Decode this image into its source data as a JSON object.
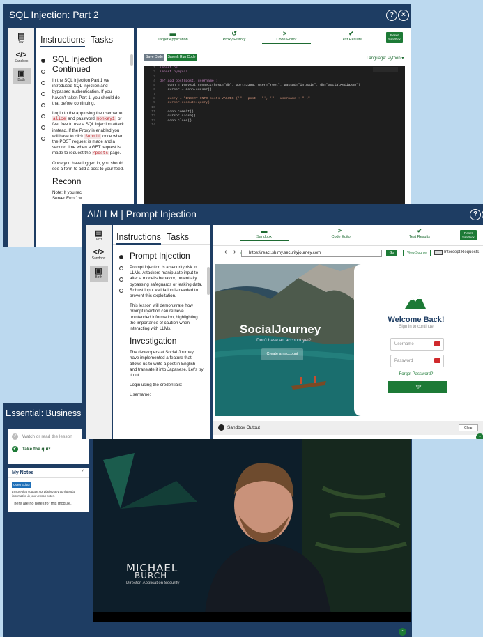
{
  "win1": {
    "title": "SQL Injection: Part 2",
    "help_icon": "?",
    "close_icon": "×",
    "sidebar": [
      {
        "label": "Text"
      },
      {
        "label": "Sandbox"
      },
      {
        "label": "Both"
      }
    ],
    "tabs": [
      "Instructions",
      "Tasks"
    ],
    "heading": "SQL Injection Continued",
    "p1": "In the SQL Injection Part 1 we introduced SQL Injection and bypassed authentication. If you haven't taken Part 1, you should do that before continuing.",
    "p2_a": "Login to the app using the username ",
    "p2_user": "alice",
    "p2_b": " and password ",
    "p2_pass": "monkey1",
    "p2_c": ", or feel free to use a SQL Injection attack instead. If the Proxy is enabled you will have to click ",
    "p2_submit": "Submit",
    "p2_d": " once when the POST request is made and a second time when a GET request is made to request the ",
    "p2_posts": "/posts",
    "p2_e": " page.",
    "p3": "Once you have logged in, you should see a form to add a post to your feed.",
    "heading2": "Reconn",
    "note": "Note: If you rec",
    "note2": "Server Error\" w",
    "nav": [
      {
        "label": "Target Application",
        "icon": "▬"
      },
      {
        "label": "Proxy History",
        "icon": "↺"
      },
      {
        "label": "Code Editor",
        "icon": ">_"
      },
      {
        "label": "Test Results",
        "icon": "✔"
      }
    ],
    "reset_l1": "Reset",
    "reset_l2": "Sandbox",
    "save_code": "Save Code",
    "save_run": "Save & Run Code",
    "language": "Language: Python ▾",
    "line_numbers": [
      "1",
      "2",
      "3",
      "4",
      "5",
      "6",
      "7",
      "8",
      "9",
      "10",
      "11",
      "12",
      "13",
      "14"
    ],
    "code": [
      "import os",
      "import pymysql",
      "",
      "def add_post(post, username):",
      "    conn = pymysql.connect(host=\"db\", port=3306, user=\"root\", passwd=\"intmain\", db=\"SocialMediaApp\")",
      "    cursor = conn.cursor()",
      "",
      "    query = \"INSERT INTO posts VALUES ('\" + post + \"', '\" + username + \"')\"",
      "    cursor.execute(query)",
      "",
      "    conn.commit()",
      "    cursor.close()",
      "    conn.close()",
      ""
    ]
  },
  "win2": {
    "title": "AI/LLM | Prompt Injection",
    "help_icon": "?",
    "close_icon": "×",
    "sidebar": [
      {
        "label": "Text"
      },
      {
        "label": "Sandbox"
      },
      {
        "label": "Both"
      }
    ],
    "tabs": [
      "Instructions",
      "Tasks"
    ],
    "heading": "Prompt Injection",
    "p1": "Prompt injection is a security risk in LLMs. Attackers manipulate input to alter a model's behavior, potentially bypassing safeguards or leaking data. Robust input validation is needed to prevent this exploitation.",
    "p2": "This lesson will demonstrate how prompt injection can retrieve unintended information, highlighting the importance of caution when interacting with LLMs.",
    "heading2": "Investigation",
    "p3": "The developers at Social Journey have implemented a feature that allows us to write a post in English and translate it into Japanese. Let's try it out.",
    "p4": "Login using the credentials:",
    "p5": "Username:",
    "nav": [
      {
        "label": "Sandbox",
        "icon": "▬"
      },
      {
        "label": "Code Editor",
        "icon": ">_"
      },
      {
        "label": "Test Results",
        "icon": "✔"
      }
    ],
    "reset_l1": "Reset",
    "reset_l2": "Sandbox",
    "url": "https://react.sb.my.securityjourney.com",
    "go": "Go",
    "view_source": "View Source",
    "intercept": "Intercept Requests",
    "brand": "SocialJourney",
    "no_account": "Don't have an account yet?",
    "create_account": "Create an account",
    "welcome": "Welcome Back!",
    "signin": "Sign in to continue",
    "username_ph": "Username",
    "password_ph": "Password",
    "forgot": "Forgot Password?",
    "login": "Login",
    "output": "Sandbox Output",
    "clear": "Clear"
  },
  "win3": {
    "title": "Essential: Business",
    "items": [
      {
        "label": "Watch or read the lesson"
      },
      {
        "label": "Take the quiz"
      }
    ],
    "notes_title": "My Notes",
    "open_editor": "Open Editor",
    "notes_warning": "Ensure that you are not placing any confidential information in your lesson notes.",
    "notes_empty": "There are no notes for this module.",
    "speaker_first": "MICHAEL",
    "speaker_last": "BURCH",
    "speaker_role": "Director, Application Security"
  },
  "colors": {
    "frame": "#1e3d63",
    "accent_green": "#1d7a36",
    "background": "#bcd9ef"
  }
}
